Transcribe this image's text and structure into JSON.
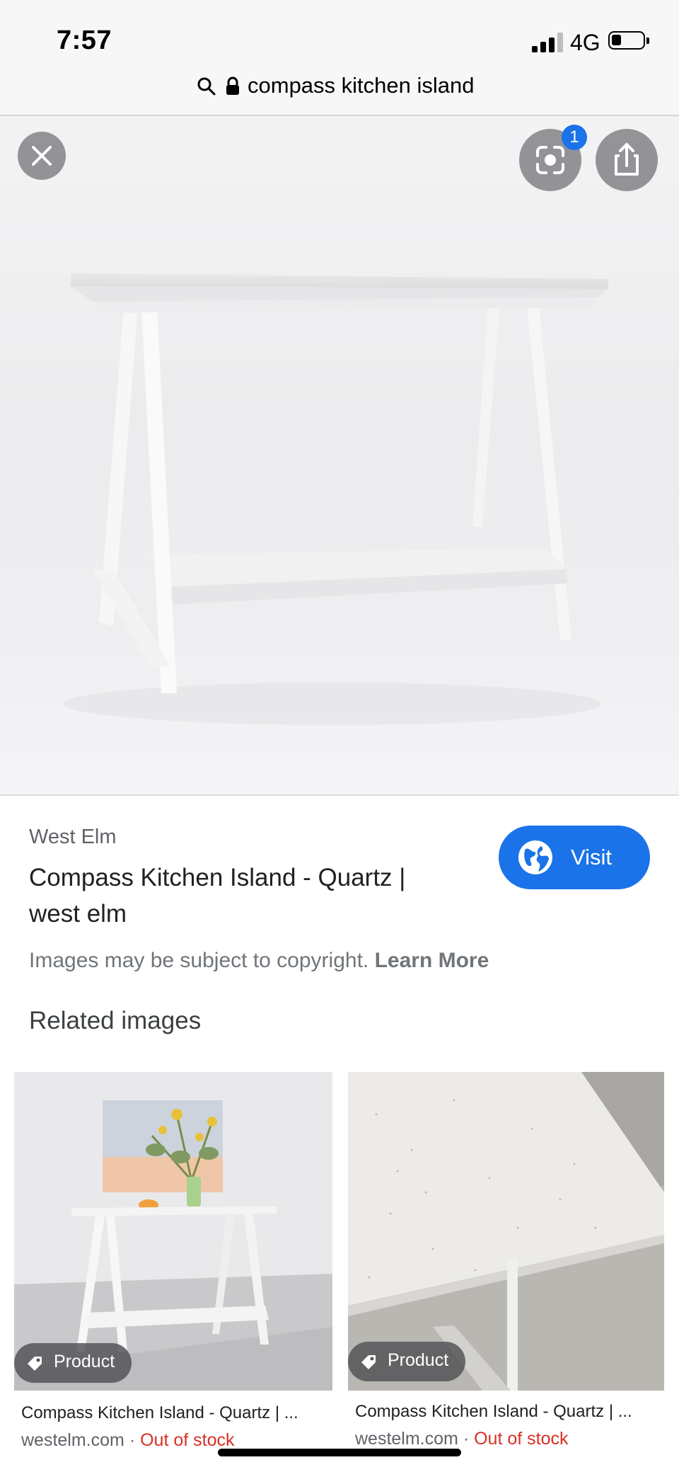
{
  "status_bar": {
    "time": "7:57",
    "network": "4G"
  },
  "address_bar": {
    "url_text": "compass kitchen island"
  },
  "viewer": {
    "lens_badge_count": "1"
  },
  "result": {
    "source": "West Elm",
    "title": "Compass Kitchen Island - Quartz | west elm",
    "visit_label": "Visit",
    "copyright_text": "Images may be subject to copyright.",
    "learn_more_label": "Learn More"
  },
  "related": {
    "heading": "Related images",
    "items": [
      {
        "badge": "Product",
        "title": "Compass Kitchen Island - Quartz | ...",
        "site": "westelm.com",
        "separator": "·",
        "stock": "Out of stock"
      },
      {
        "badge": "Product",
        "title": "Compass Kitchen Island - Quartz | ...",
        "site": "westelm.com",
        "separator": "·",
        "stock": "Out of stock"
      }
    ]
  },
  "colors": {
    "accent": "#1a73e8",
    "out_of_stock": "#d93025"
  },
  "icons": [
    "search-icon",
    "lock-icon",
    "close-icon",
    "lens-icon",
    "share-icon",
    "globe-icon",
    "tag-icon"
  ]
}
